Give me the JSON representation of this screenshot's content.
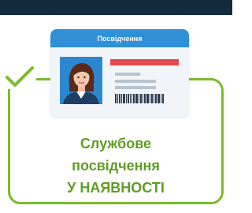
{
  "card": {
    "header_label": "Посвідчення"
  },
  "caption": {
    "line1": "Службове",
    "line2": "посвідчення",
    "line3": "У НАЯВНОСТІ"
  },
  "colors": {
    "accent_green": "#7cba2c",
    "caption_green": "#5f9e24",
    "card_header_blue": "#2f8fd7",
    "red_stripe": "#e24a4f",
    "top_bar": "#132a3f"
  },
  "icons": {
    "status": "checkmark-icon",
    "portrait": "person-avatar-icon",
    "barcode": "barcode-icon"
  }
}
